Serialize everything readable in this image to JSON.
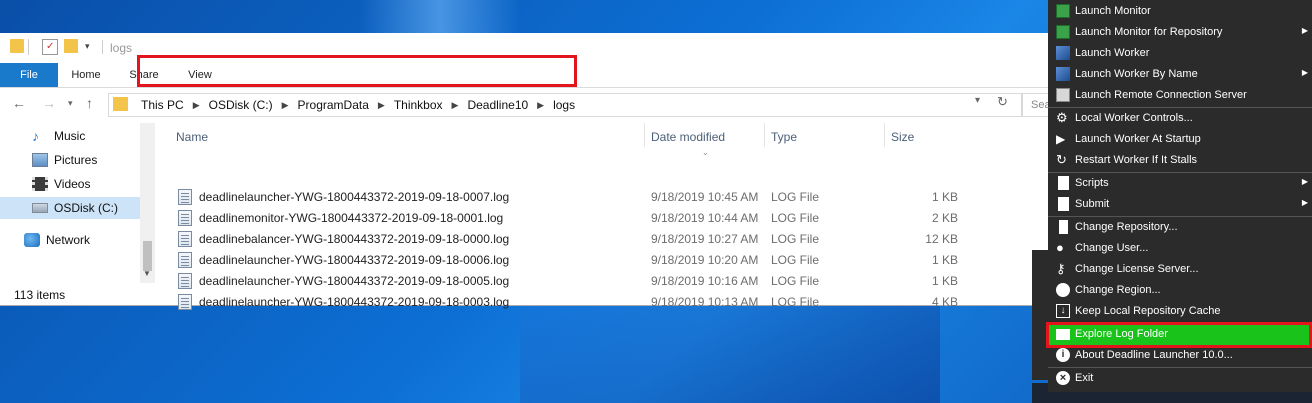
{
  "explorer": {
    "title": "logs",
    "ribbon_tabs": [
      "File",
      "Home",
      "Share",
      "View"
    ],
    "breadcrumb": [
      "This PC",
      "OSDisk (C:)",
      "ProgramData",
      "Thinkbox",
      "Deadline10",
      "logs"
    ],
    "search_placeholder": "Sea",
    "nav_items": [
      {
        "label": "Music",
        "icon": "music-icon"
      },
      {
        "label": "Pictures",
        "icon": "pictures-icon"
      },
      {
        "label": "Videos",
        "icon": "videos-icon"
      },
      {
        "label": "OSDisk (C:)",
        "icon": "drive-icon",
        "selected": true
      },
      {
        "label": "Network",
        "icon": "network-icon"
      }
    ],
    "columns": [
      "Name",
      "Date modified",
      "Type",
      "Size"
    ],
    "files": [
      {
        "name": "deadlinelauncher-YWG-1800443372-2019-09-18-0007.log",
        "date": "9/18/2019 10:45 AM",
        "type": "LOG File",
        "size": "1 KB"
      },
      {
        "name": "deadlinemonitor-YWG-1800443372-2019-09-18-0001.log",
        "date": "9/18/2019 10:44 AM",
        "type": "LOG File",
        "size": "2 KB"
      },
      {
        "name": "deadlinebalancer-YWG-1800443372-2019-09-18-0000.log",
        "date": "9/18/2019 10:27 AM",
        "type": "LOG File",
        "size": "12 KB"
      },
      {
        "name": "deadlinelauncher-YWG-1800443372-2019-09-18-0006.log",
        "date": "9/18/2019 10:20 AM",
        "type": "LOG File",
        "size": "1 KB"
      },
      {
        "name": "deadlinelauncher-YWG-1800443372-2019-09-18-0005.log",
        "date": "9/18/2019 10:16 AM",
        "type": "LOG File",
        "size": "1 KB"
      },
      {
        "name": "deadlinelauncher-YWG-1800443372-2019-09-18-0003.log",
        "date": "9/18/2019 10:13 AM",
        "type": "LOG File",
        "size": "4 KB"
      }
    ],
    "status": "113 items"
  },
  "menu": {
    "items": [
      {
        "label": "Launch Monitor",
        "icon": "monitor-icon"
      },
      {
        "label": "Launch Monitor for Repository",
        "icon": "monitor-icon",
        "submenu": true
      },
      {
        "label": "Launch Worker",
        "icon": "worker-icon"
      },
      {
        "label": "Launch Worker By Name",
        "icon": "worker-icon",
        "submenu": true
      },
      {
        "label": "Launch Remote Connection Server",
        "icon": "server-icon"
      },
      {
        "label": "Local Worker Controls...",
        "icon": "controls-icon"
      },
      {
        "label": "Launch Worker At Startup",
        "icon": "play-icon"
      },
      {
        "label": "Restart Worker If It Stalls",
        "icon": "restart-icon"
      },
      {
        "label": "Scripts",
        "icon": "document-icon",
        "submenu": true
      },
      {
        "label": "Submit",
        "icon": "document-icon",
        "submenu": true
      },
      {
        "label": "Change Repository...",
        "icon": "repository-icon"
      },
      {
        "label": "Change User...",
        "icon": "user-icon"
      },
      {
        "label": "Change License Server...",
        "icon": "key-icon"
      },
      {
        "label": "Change Region...",
        "icon": "globe-icon"
      },
      {
        "label": "Keep Local Repository Cache",
        "icon": "checkbox-icon"
      },
      {
        "label": "Explore Log Folder",
        "icon": "folder-icon",
        "highlighted": true
      },
      {
        "label": "About Deadline Launcher 10.0...",
        "icon": "info-icon"
      },
      {
        "label": "Exit",
        "icon": "exit-icon"
      }
    ],
    "highlight_color": "#19c319",
    "annotation_color": "#e3141c"
  }
}
